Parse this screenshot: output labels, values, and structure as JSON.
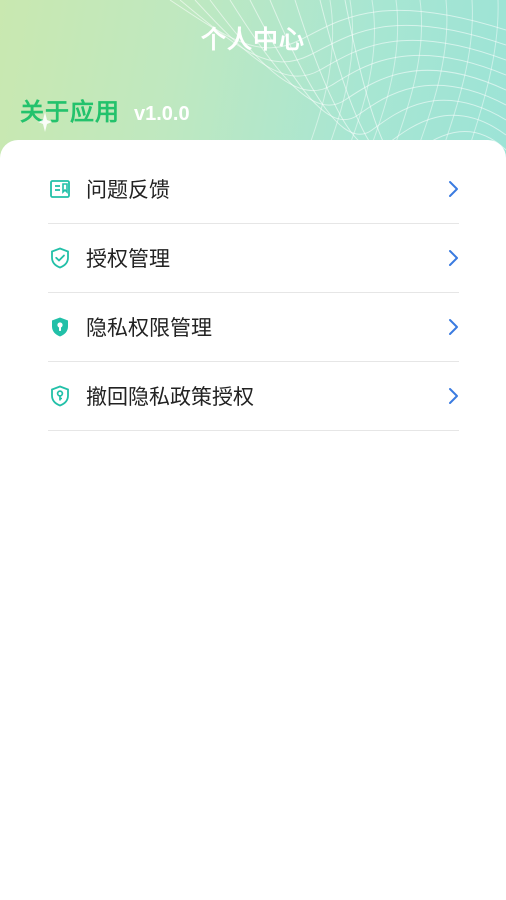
{
  "header": {
    "title": "个人中心",
    "about_title": "关于应用",
    "version": "v1.0.0"
  },
  "menu": {
    "items": [
      {
        "label": "问题反馈",
        "icon": "feedback-icon"
      },
      {
        "label": "授权管理",
        "icon": "shield-check-icon"
      },
      {
        "label": "隐私权限管理",
        "icon": "privacy-shield-icon"
      },
      {
        "label": "撤回隐私政策授权",
        "icon": "revoke-shield-icon"
      }
    ]
  },
  "colors": {
    "accent": "#23c26c",
    "icon": "#22c0a8",
    "chevron": "#3a7be0",
    "header_gradient_start": "#c9e8b0",
    "header_gradient_end": "#9ce3d6"
  }
}
